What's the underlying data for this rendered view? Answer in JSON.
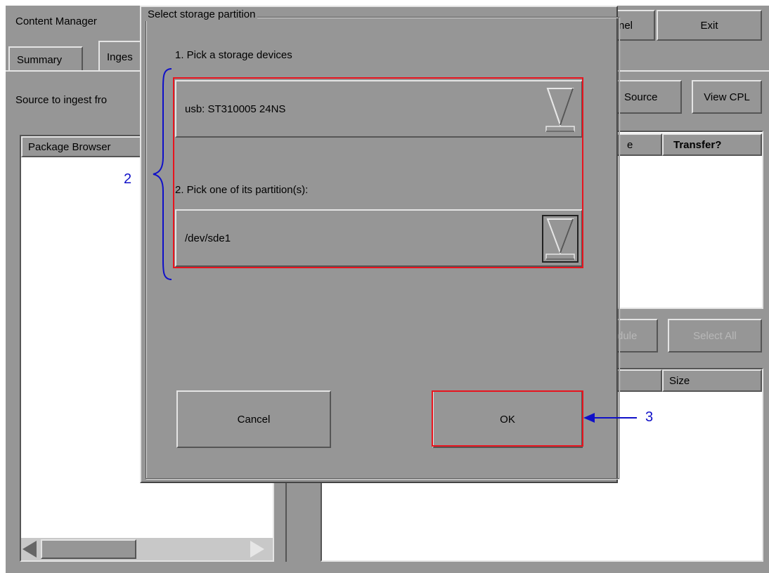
{
  "app": {
    "title": "Content Manager",
    "tabs": [
      {
        "label": "Summary"
      },
      {
        "label": "Inges"
      }
    ],
    "top_buttons": {
      "cancel_partial": "nel",
      "exit": "Exit"
    },
    "source_label": "Source to ingest fro",
    "source_button": "Source",
    "view_cpl_button": "View CPL",
    "package_browser_header": "Package Browser",
    "right_table_headers": {
      "partial": "e",
      "transfer": "Transfer?"
    },
    "middle_buttons": {
      "schedule_partial": "dule",
      "select_all": "Select All"
    },
    "lower_table_headers": {
      "size": "Size"
    }
  },
  "dialog": {
    "title": "Select storage partition",
    "step1_label": "1. Pick a storage devices",
    "device_value": "usb: ST310005 24NS",
    "step2_label": "2. Pick one of its partition(s):",
    "partition_value": "/dev/sde1",
    "cancel_button": "Cancel",
    "ok_button": "OK"
  },
  "annotations": {
    "label_2": "2",
    "label_3": "3",
    "highlight_color": "#e8141e",
    "annotation_color": "#1010c8"
  }
}
